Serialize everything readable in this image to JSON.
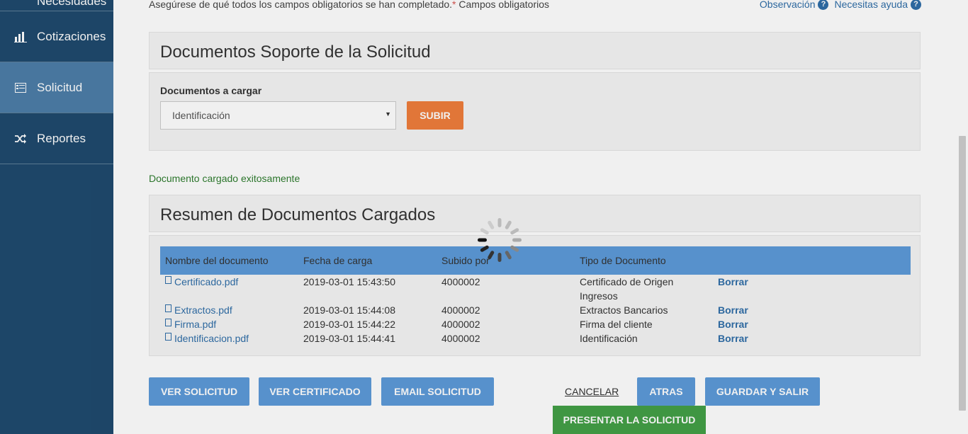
{
  "sidebar": {
    "items": [
      {
        "label": "Necesidades",
        "icon": "needs-icon"
      },
      {
        "label": "Cotizaciones",
        "icon": "bar-chart-icon"
      },
      {
        "label": "Solicitud",
        "icon": "form-icon"
      },
      {
        "label": "Reportes",
        "icon": "shuffle-icon"
      }
    ],
    "active": "Solicitud"
  },
  "header": {
    "note": "Asegúrese de qué todos los campos obligatorios se han completado.",
    "required_mark": "*",
    "required_label": "Campos obligatorios",
    "observacion_link": "Observación",
    "ayuda_link": "Necesitas ayuda",
    "help_glyph": "?"
  },
  "upload": {
    "title": "Documentos Soporte de la Solicitud",
    "label": "Documentos a cargar",
    "selected": "Identificación",
    "button": "SUBIR"
  },
  "status": {
    "message": "Documento cargado exitosamente"
  },
  "summary": {
    "title": "Resumen de Documentos Cargados",
    "columns": [
      "Nombre del documento",
      "Fecha de carga",
      "Subido por",
      "Tipo de Documento"
    ],
    "rows": [
      {
        "name": "Certificado.pdf",
        "date": "2019-03-01 15:43:50",
        "by": "4000002",
        "type": "Certificado de Origen Ingresos",
        "action": "Borrar"
      },
      {
        "name": "Extractos.pdf",
        "date": "2019-03-01 15:44:08",
        "by": "4000002",
        "type": "Extractos Bancarios",
        "action": "Borrar"
      },
      {
        "name": "Firma.pdf",
        "date": "2019-03-01 15:44:22",
        "by": "4000002",
        "type": "Firma del cliente",
        "action": "Borrar"
      },
      {
        "name": "Identificacion.pdf",
        "date": "2019-03-01 15:44:41",
        "by": "4000002",
        "type": "Identificación",
        "action": "Borrar"
      }
    ]
  },
  "actions": {
    "ver_solicitud": "VER SOLICITUD",
    "ver_certificado": "VER CERTIFICADO",
    "email_solicitud": "EMAIL SOLICITUD",
    "cancelar": "CANCELAR",
    "atras": "ATRAS",
    "guardar": "GUARDAR Y SALIR",
    "presentar": "PRESENTAR LA SOLICITUD"
  },
  "colors": {
    "sidebar": "#1f4a6e",
    "active": "#4d7ea8",
    "primary": "#5d9bd9",
    "subir": "#f07e3c",
    "presentar": "#43a047",
    "success": "#2e7d2e"
  }
}
